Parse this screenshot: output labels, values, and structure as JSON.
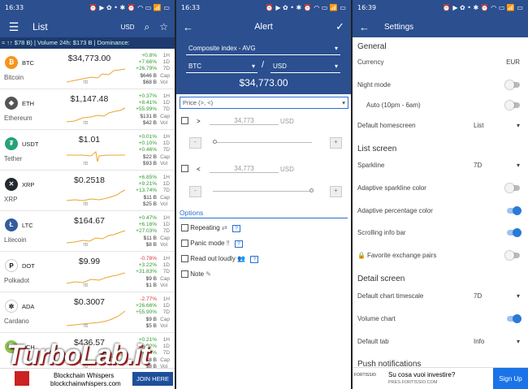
{
  "p1": {
    "status": {
      "time": "16:33",
      "icons": "⏰ ▶ ✿ • ✱ ⏰ ◠ ▭ 📶 ▭"
    },
    "title": "List",
    "currency": "USD",
    "ticker": "≈ ↑↑ $78 B)   |   Volume 24h:  $173 B   |   Dominance:",
    "coins": [
      {
        "sym": "BTC",
        "name": "Bitcoin",
        "price": "$34,773.00",
        "c1": "+0.8%",
        "c2": "+7.66%",
        "c3": "+26.79%",
        "cap": "$646 B",
        "vol": "$68 B",
        "color": "#f7931a",
        "glyph": "₿"
      },
      {
        "sym": "ETH",
        "name": "Ethereum",
        "price": "$1,147.48",
        "c1": "+0.37%",
        "c2": "+8.41%",
        "c3": "+55.99%",
        "cap": "$131 B",
        "vol": "$42 B",
        "color": "#555",
        "glyph": "◆"
      },
      {
        "sym": "USDT",
        "name": "Tether",
        "price": "$1.01",
        "c1": "+0.01%",
        "c2": "+0.10%",
        "c3": "+0.46%",
        "cap": "$22 B",
        "vol": "$93 B",
        "color": "#26a17b",
        "glyph": "₮"
      },
      {
        "sym": "XRP",
        "name": "XRP",
        "price": "$0.2518",
        "c1": "+6.85%",
        "c2": "+9.21%",
        "c3": "+13.74%",
        "cap": "$11 B",
        "vol": "$25 B",
        "color": "#23292f",
        "glyph": "✕"
      },
      {
        "sym": "LTC",
        "name": "Litecoin",
        "price": "$164.67",
        "c1": "+0.47%",
        "c2": "+6.16%",
        "c3": "+27.03%",
        "cap": "$11 B",
        "vol": "$8 B",
        "color": "#345d9d",
        "glyph": "Ł"
      },
      {
        "sym": "DOT",
        "name": "Polkadot",
        "price": "$9.99",
        "c1": "-0.78%",
        "c2": "+3.22%",
        "c3": "+31.83%",
        "cap": "$9 B",
        "vol": "$1 B",
        "color": "#fff",
        "glyph": "P"
      },
      {
        "sym": "ADA",
        "name": "Cardano",
        "price": "$0.3007",
        "c1": "-2.77%",
        "c2": "+26.66%",
        "c3": "+55.90%",
        "cap": "$9 B",
        "vol": "$5 B",
        "color": "#fff",
        "glyph": "✲"
      },
      {
        "sym": "BCH",
        "name": "",
        "price": "$436.57",
        "c1": "+0.21%",
        "c2": "+6.02%",
        "c3": "+27.64%",
        "cap": "$8 B",
        "vol": "$8 B",
        "color": "#8dc351",
        "glyph": "₿"
      }
    ],
    "ad": {
      "name": "Blockchain Whispers",
      "url": "blockchainwhispers.com",
      "cta": "JOIN HERE"
    },
    "watermark": "TurboLab.it"
  },
  "p2": {
    "status": {
      "time": "16:33"
    },
    "title": "Alert",
    "index": "Composite index - AVG",
    "coin": "BTC",
    "currency": "USD",
    "price": "$34,773.00",
    "type": "Price (>, <)",
    "above": {
      "op": ">",
      "value": "34,773",
      "unit": "USD",
      "minus": "-",
      "plus": "+"
    },
    "below": {
      "op": "<",
      "value": "34,773",
      "unit": "USD",
      "minus": "-",
      "plus": "+"
    },
    "options_title": "Options",
    "opts": [
      {
        "label": "Repeating",
        "help": "?"
      },
      {
        "label": "Panic mode",
        "help": "?"
      },
      {
        "label": "Read out loudly",
        "help": "?"
      },
      {
        "label": "Note"
      }
    ]
  },
  "p3": {
    "status": {
      "time": "16:39"
    },
    "title": "Settings",
    "general": "General",
    "currency_label": "Currency",
    "currency_value": "EUR",
    "night": "Night mode",
    "auto": "Auto (10pm - 6am)",
    "homescreen": "Default homescreen",
    "homescreen_value": "List",
    "listscreen": "List screen",
    "sparkline": "Sparkline",
    "sparkline_value": "7D",
    "adaptive_spark": "Adaptive sparkline color",
    "adaptive_pct": "Adaptive percentage color",
    "scrolling": "Scrolling info bar",
    "fav": "Favorite exchange pairs",
    "detail": "Detail screen",
    "timescale": "Default chart timescale",
    "timescale_value": "7D",
    "volume": "Volume chart",
    "tab": "Default tab",
    "tab_value": "Info",
    "push": "Push notifications",
    "ad": {
      "brand": "FORTISSIO",
      "title": "Su cosa vuoi investire?",
      "url": "PRES.FORTISSIO.COM",
      "cta": "Sign Up"
    }
  },
  "labels": {
    "h": "1H",
    "d": "1D",
    "w": "7D",
    "cap": "Cap",
    "vol": "Vol",
    "d7": "7D"
  }
}
